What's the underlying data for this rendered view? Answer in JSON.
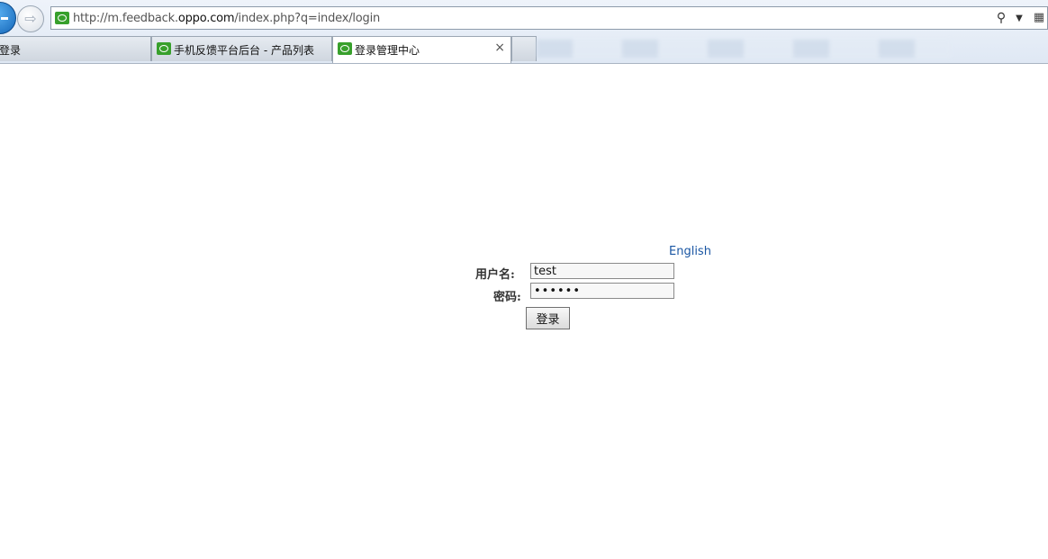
{
  "browser": {
    "url_prefix": "http://m.feedback.",
    "url_domain": "oppo.com",
    "url_suffix": "/index.php?q=index/login",
    "tabs": [
      {
        "label": "登录"
      },
      {
        "label": "手机反馈平台后台 - 产品列表"
      },
      {
        "label": "登录管理中心",
        "active": true
      }
    ],
    "tab_close_glyph": "×",
    "search_glyph": "⚲",
    "dropdown_glyph": "▼",
    "forward_glyph": "⇨",
    "compat_glyph": "▦"
  },
  "login": {
    "language_link": "English",
    "username_label": "用户名:",
    "username_value": "test",
    "password_label": "密码:",
    "password_value": "••••••",
    "submit_label": "登录"
  }
}
